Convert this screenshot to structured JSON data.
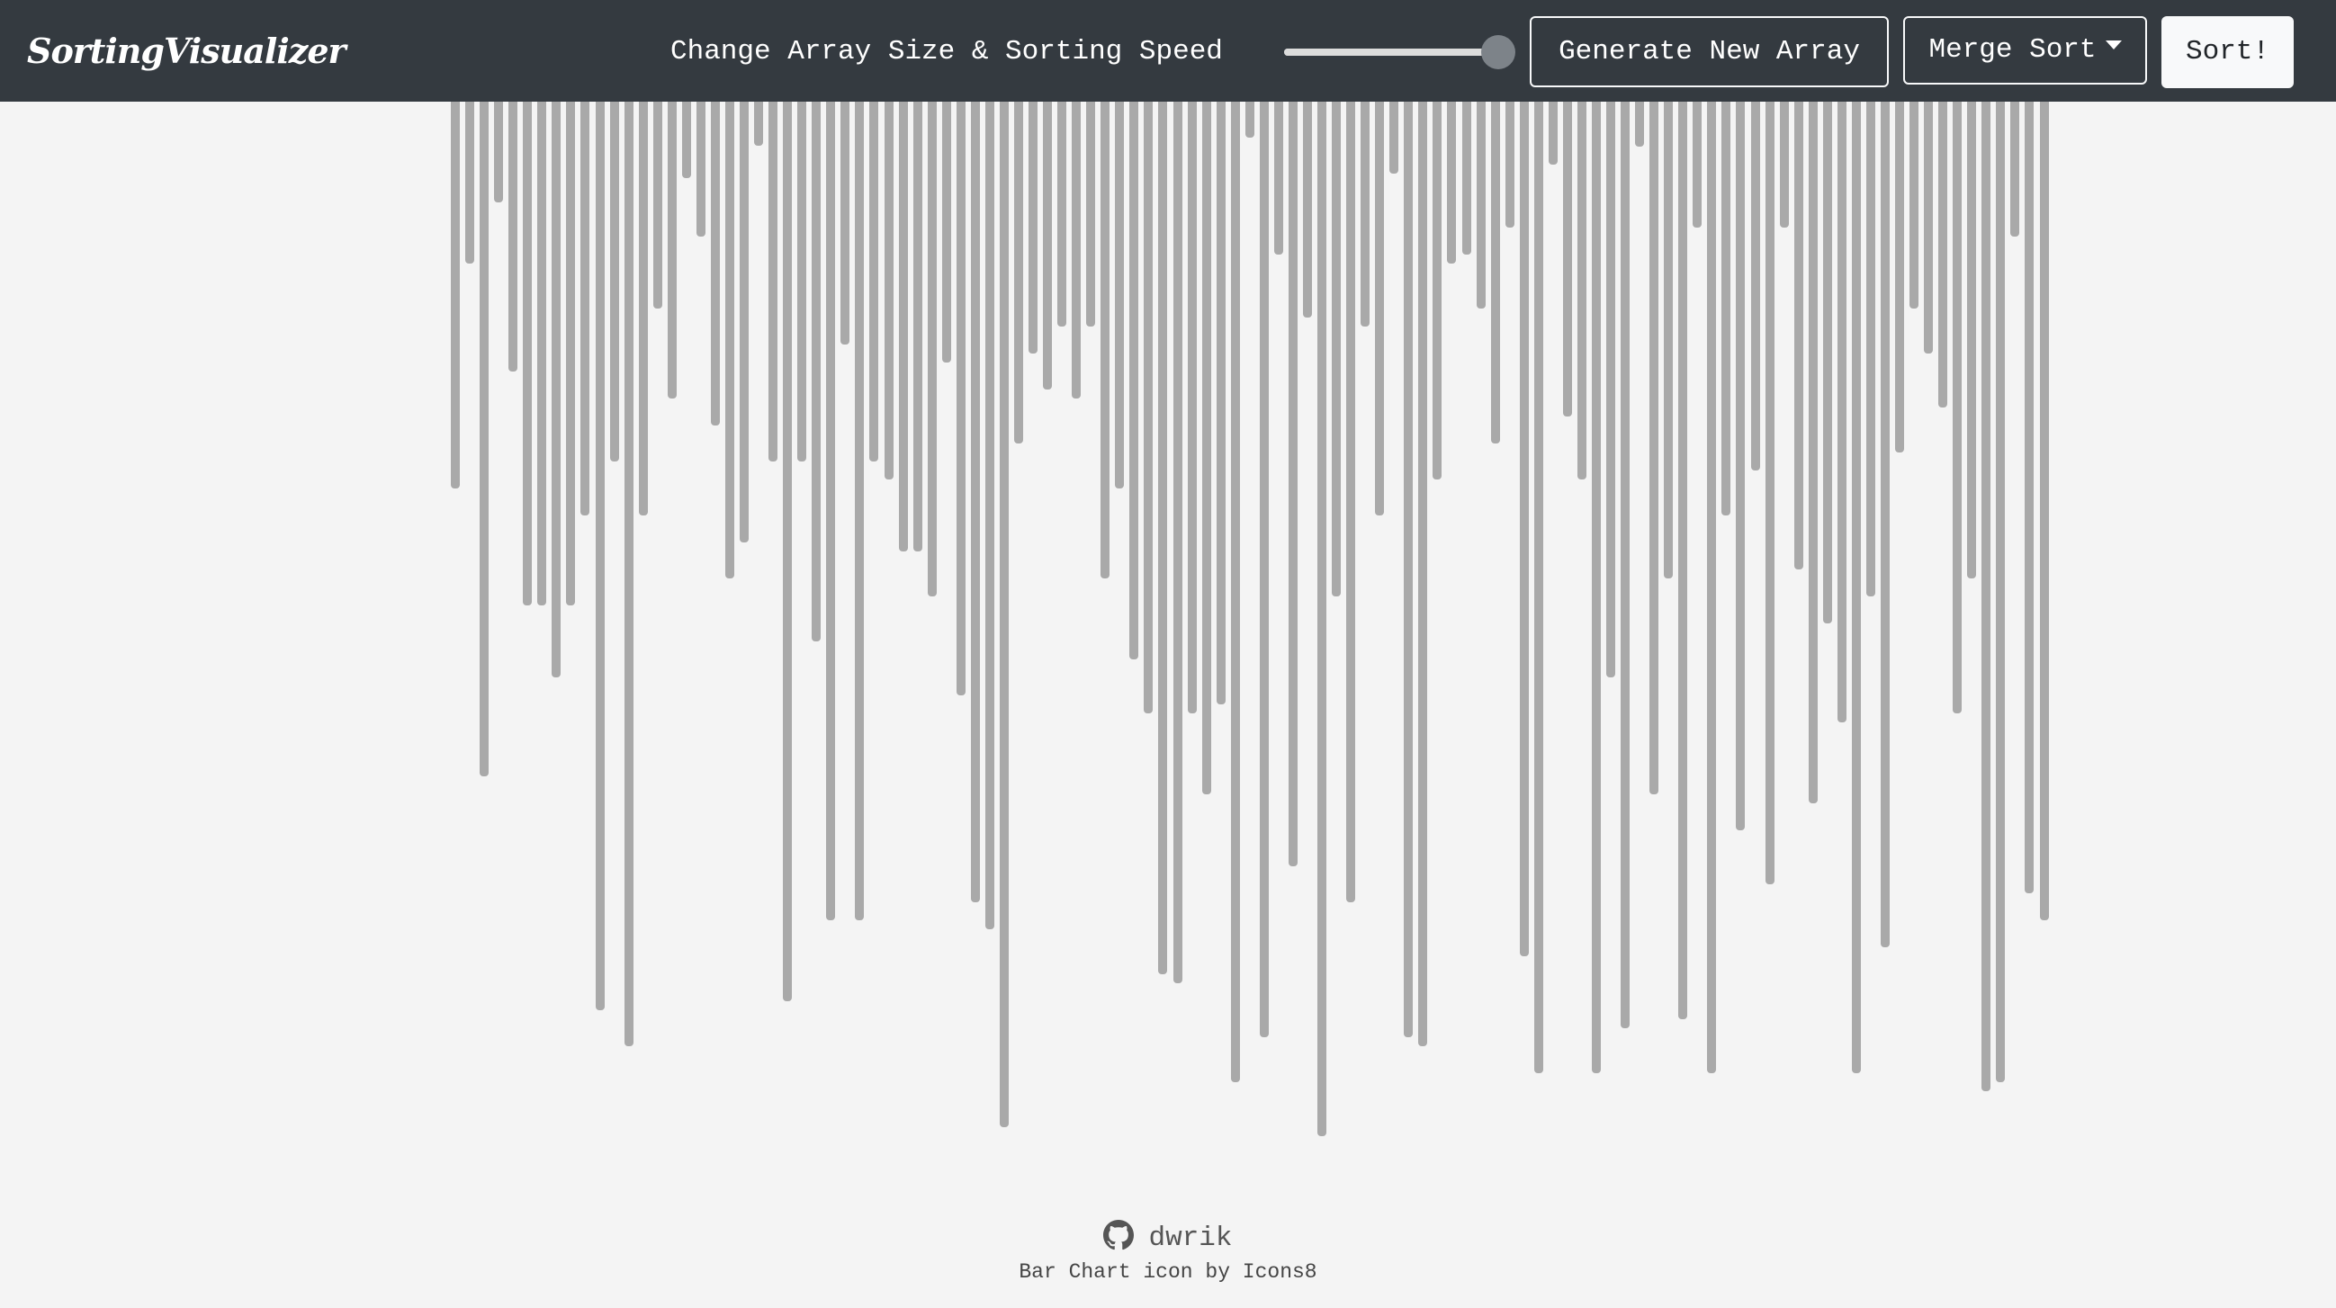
{
  "navbar": {
    "brand": "SortingVisualizer",
    "range_label": "Change Array Size & Sorting Speed",
    "slider_value_percent": 97,
    "generate_label": "Generate New Array",
    "algorithm_label": "Merge Sort",
    "sort_label": "Sort!"
  },
  "colors": {
    "navbar_bg": "#343a40",
    "bar": "#a9a9a9",
    "page_bg": "#f4f4f4"
  },
  "array": {
    "values": [
      430,
      180,
      750,
      112,
      300,
      560,
      560,
      640,
      560,
      460,
      1010,
      400,
      1050,
      460,
      230,
      330,
      85,
      150,
      360,
      530,
      490,
      49,
      400,
      1000,
      400,
      600,
      910,
      270,
      910,
      400,
      420,
      500,
      500,
      550,
      290,
      660,
      890,
      920,
      1140,
      380,
      280,
      320,
      250,
      330,
      250,
      530,
      430,
      620,
      680,
      970,
      980,
      680,
      770,
      670,
      1090,
      40,
      1040,
      170,
      850,
      240,
      1150,
      550,
      890,
      250,
      460,
      80,
      1040,
      1050,
      420,
      180,
      170,
      230,
      380,
      140,
      950,
      1080,
      70,
      350,
      420,
      1080,
      640,
      1030,
      50,
      770,
      530,
      1020,
      140,
      1080,
      460,
      810,
      410,
      870,
      140,
      520,
      780,
      580,
      690,
      1080,
      550,
      940,
      390,
      230,
      280,
      340,
      680,
      530,
      1100,
      1090,
      150,
      880,
      910
    ]
  },
  "footer": {
    "github_user": "dwrik",
    "credit": "Bar Chart icon by Icons8"
  }
}
